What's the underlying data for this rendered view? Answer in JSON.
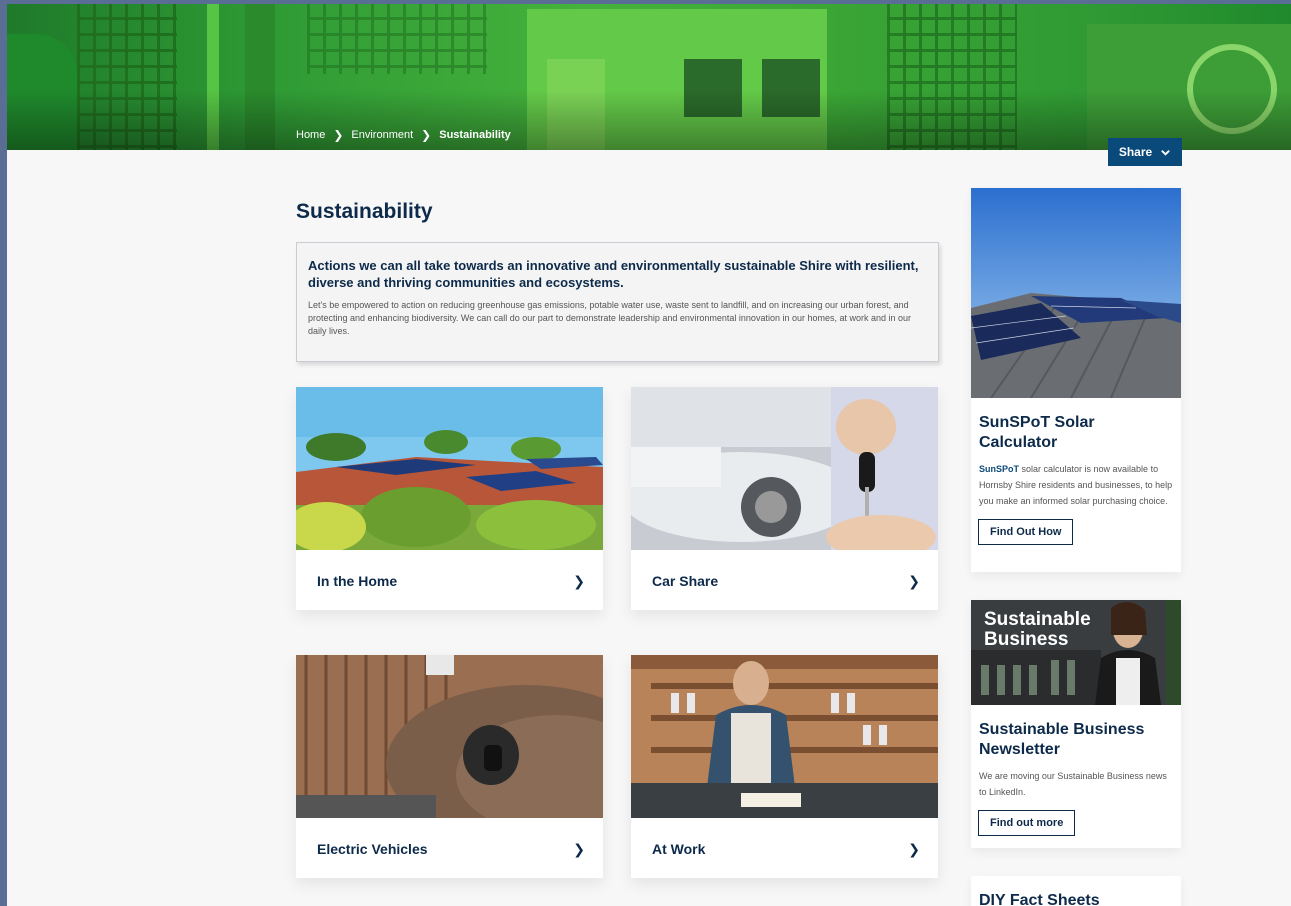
{
  "breadcrumb": {
    "items": [
      "Home",
      "Environment",
      "Sustainability"
    ]
  },
  "share_label": "Share",
  "page_title": "Sustainability",
  "intro": {
    "heading": "Actions we can all take towards an innovative and environmentally sustainable Shire with resilient, diverse and thriving communities and ecosystems.",
    "body": "Let's be empowered to action on reducing greenhouse gas emissions, potable water use, waste sent to landfill, and on increasing our urban forest, and protecting and enhancing biodiversity. We can call do our part to demonstrate leadership and environmental innovation in our homes, at work and in our daily lives."
  },
  "cards": [
    {
      "label": "In the Home"
    },
    {
      "label": "Car Share"
    },
    {
      "label": "Electric Vehicles"
    },
    {
      "label": "At Work"
    }
  ],
  "sidebar": {
    "solar": {
      "title": "SunSPoT Solar Calculator",
      "brand": "SunSPoT",
      "body": " solar calculator is now available to Hornsby Shire residents and businesses, to help you make an informed solar purchasing choice.",
      "button": "Find Out How"
    },
    "business": {
      "image_text": "Sustainable Business",
      "title": "Sustainable Business Newsletter",
      "body": "We are moving our Sustainable Business news to LinkedIn.",
      "button": "Find out more"
    },
    "diy": {
      "title": "DIY Fact Sheets"
    }
  },
  "colors": {
    "navy": "#0d2a4a",
    "share_bg": "#0a4a7a",
    "hero_green": "#3aa535"
  }
}
